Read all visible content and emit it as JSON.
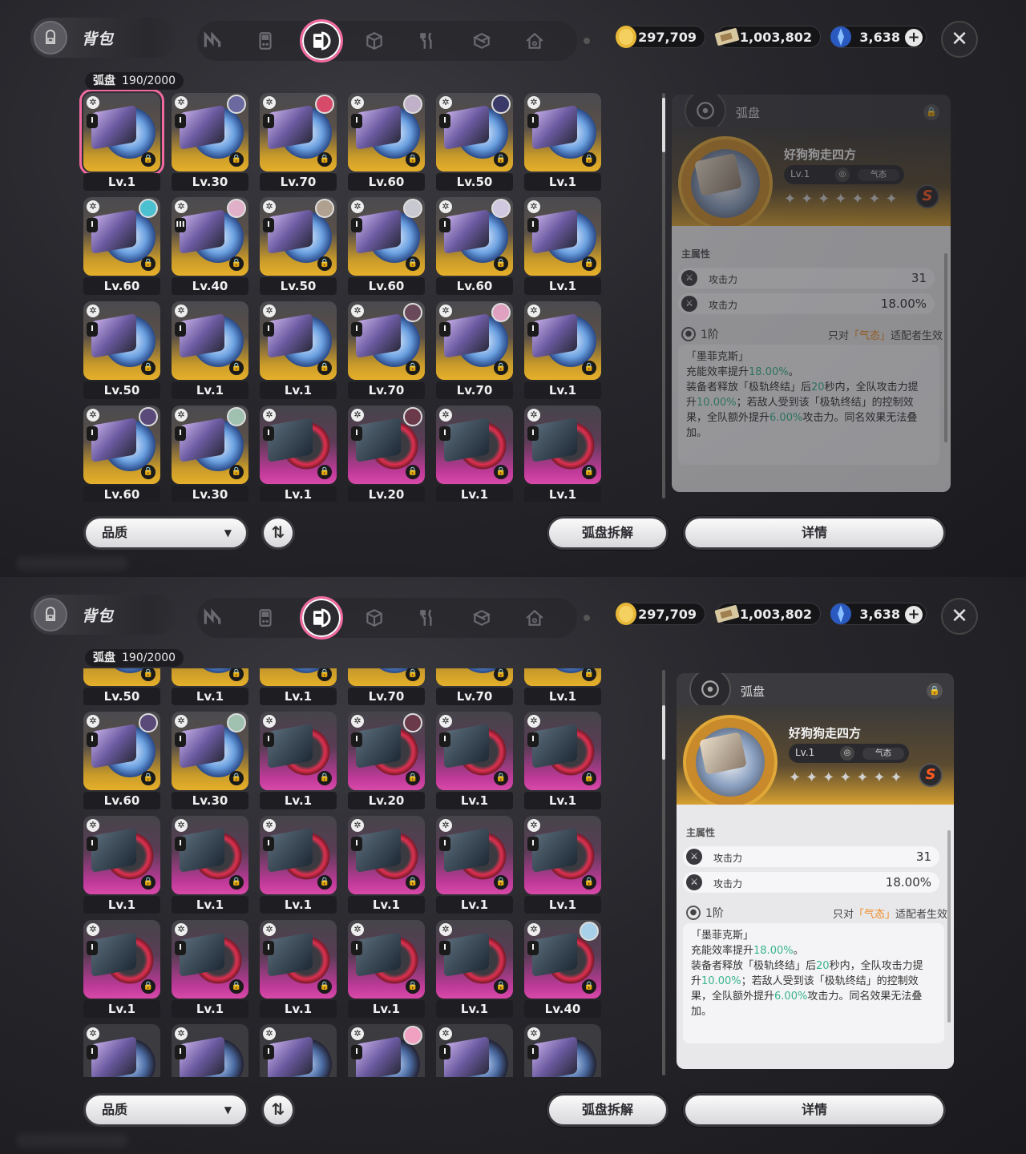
{
  "header": {
    "bag_title": "背包",
    "bag_icon": "backpack-icon",
    "tabs": [
      {
        "name": "agent-tab",
        "icon": "n-logo-icon"
      },
      {
        "name": "bangboo-tab",
        "icon": "handheld-icon"
      },
      {
        "name": "disc-tab",
        "icon": "disc-card-icon",
        "active": true
      },
      {
        "name": "material-tab",
        "icon": "cube-icon"
      },
      {
        "name": "food-tab",
        "icon": "fork-knife-icon"
      },
      {
        "name": "package-tab",
        "icon": "box-icon"
      },
      {
        "name": "home-tab",
        "icon": "house-icon"
      }
    ],
    "currency": {
      "dennies": "297,709",
      "film": "1,003,802",
      "polychrome": "3,638"
    },
    "close_icon": "close-icon"
  },
  "inventory": {
    "label": "弧盘",
    "count": "190/2000"
  },
  "grid_panel_1": [
    [
      {
        "lv": "Lv.1",
        "theme": "gold",
        "sel": true,
        "roman": "I"
      },
      {
        "lv": "Lv.30",
        "theme": "gold",
        "roman": "I",
        "ava": "#6a6aa0"
      },
      {
        "lv": "Lv.70",
        "theme": "gold",
        "roman": "I",
        "ava": "#d84a6a"
      },
      {
        "lv": "Lv.60",
        "theme": "gold",
        "roman": "I",
        "ava": "#c0b0c8"
      },
      {
        "lv": "Lv.50",
        "theme": "gold",
        "roman": "I",
        "ava": "#3a3a6a"
      },
      {
        "lv": "Lv.1",
        "theme": "gold",
        "roman": "I"
      }
    ],
    [
      {
        "lv": "Lv.60",
        "theme": "gold",
        "roman": "I",
        "ava": "#4ac0d0"
      },
      {
        "lv": "Lv.40",
        "theme": "gold",
        "roman": "III",
        "ava": "#e0b0c8"
      },
      {
        "lv": "Lv.50",
        "theme": "gold",
        "roman": "I",
        "ava": "#b0a090"
      },
      {
        "lv": "Lv.60",
        "theme": "gold",
        "roman": "I",
        "ava": "#c8c8d0"
      },
      {
        "lv": "Lv.60",
        "theme": "gold",
        "roman": "I",
        "ava": "#d0c8e0"
      },
      {
        "lv": "Lv.1",
        "theme": "gold",
        "roman": "I"
      }
    ],
    [
      {
        "lv": "Lv.50",
        "theme": "gold",
        "roman": "I"
      },
      {
        "lv": "Lv.1",
        "theme": "gold",
        "roman": "I"
      },
      {
        "lv": "Lv.1",
        "theme": "gold",
        "roman": "I"
      },
      {
        "lv": "Lv.70",
        "theme": "gold",
        "roman": "I",
        "ava": "#6a4a5a"
      },
      {
        "lv": "Lv.70",
        "theme": "gold",
        "roman": "I",
        "ava": "#e0a0c0"
      },
      {
        "lv": "Lv.1",
        "theme": "gold",
        "roman": "I"
      }
    ],
    [
      {
        "lv": "Lv.60",
        "theme": "gold",
        "roman": "I",
        "ava": "#5a4a7a"
      },
      {
        "lv": "Lv.30",
        "theme": "gold",
        "roman": "I",
        "ava": "#a0c0b0"
      },
      {
        "lv": "Lv.1",
        "theme": "pink",
        "roman": "I"
      },
      {
        "lv": "Lv.20",
        "theme": "pink",
        "roman": "I",
        "ava": "#6a3a4a"
      },
      {
        "lv": "Lv.1",
        "theme": "pink",
        "roman": "I"
      },
      {
        "lv": "Lv.1",
        "theme": "pink",
        "roman": "I"
      }
    ]
  ],
  "grid_panel_2": [
    [
      {
        "lv": "Lv.50",
        "theme": "gold",
        "roman": "I"
      },
      {
        "lv": "Lv.1",
        "theme": "gold",
        "roman": "I"
      },
      {
        "lv": "Lv.1",
        "theme": "gold",
        "roman": "I"
      },
      {
        "lv": "Lv.70",
        "theme": "gold",
        "roman": "I"
      },
      {
        "lv": "Lv.70",
        "theme": "gold",
        "roman": "I"
      },
      {
        "lv": "Lv.1",
        "theme": "gold",
        "roman": "I"
      }
    ],
    [
      {
        "lv": "Lv.60",
        "theme": "gold",
        "roman": "I",
        "ava": "#5a4a7a"
      },
      {
        "lv": "Lv.30",
        "theme": "gold",
        "roman": "I",
        "ava": "#a0c0b0"
      },
      {
        "lv": "Lv.1",
        "theme": "pink",
        "roman": "I"
      },
      {
        "lv": "Lv.20",
        "theme": "pink",
        "roman": "I",
        "ava": "#6a3a4a"
      },
      {
        "lv": "Lv.1",
        "theme": "pink",
        "roman": "I"
      },
      {
        "lv": "Lv.1",
        "theme": "pink",
        "roman": "I"
      }
    ],
    [
      {
        "lv": "Lv.1",
        "theme": "pink",
        "roman": "I"
      },
      {
        "lv": "Lv.1",
        "theme": "pink",
        "roman": "I"
      },
      {
        "lv": "Lv.1",
        "theme": "pink",
        "roman": "I"
      },
      {
        "lv": "Lv.1",
        "theme": "pink",
        "roman": "I"
      },
      {
        "lv": "Lv.1",
        "theme": "pink",
        "roman": "I"
      },
      {
        "lv": "Lv.1",
        "theme": "pink",
        "roman": "I"
      }
    ],
    [
      {
        "lv": "Lv.1",
        "theme": "pink",
        "roman": "I"
      },
      {
        "lv": "Lv.1",
        "theme": "pink",
        "roman": "I"
      },
      {
        "lv": "Lv.1",
        "theme": "pink",
        "roman": "I"
      },
      {
        "lv": "Lv.1",
        "theme": "pink",
        "roman": "I"
      },
      {
        "lv": "Lv.1",
        "theme": "pink",
        "roman": "I"
      },
      {
        "lv": "Lv.40",
        "theme": "pink",
        "roman": "I",
        "ava": "#a8d0e8"
      }
    ],
    [
      {
        "lv": "",
        "theme": "dark",
        "roman": "I"
      },
      {
        "lv": "",
        "theme": "dark",
        "roman": "I"
      },
      {
        "lv": "",
        "theme": "dark",
        "roman": "I"
      },
      {
        "lv": "",
        "theme": "dark",
        "roman": "I",
        "ava": "#f0a0c0"
      },
      {
        "lv": "",
        "theme": "dark",
        "roman": "I"
      },
      {
        "lv": "",
        "theme": "dark",
        "roman": "I"
      }
    ]
  ],
  "detail": {
    "category": "弧盘",
    "name": "好狗狗走四方",
    "level": "Lv.1",
    "tag": "气态",
    "rank": "S",
    "main_attr_label": "主属性",
    "stats": [
      {
        "name": "攻击力",
        "value": "31"
      },
      {
        "name": "攻击力",
        "value": "18.00%"
      }
    ],
    "tier": "1阶",
    "tier_note_pre": "只对",
    "tier_note_tag": "「气态」",
    "tier_note_post": "适配者生效",
    "desc": {
      "title": "「墨菲克斯」",
      "l1a": "充能效率提升",
      "l1b": "18.00%",
      "l1c": "。",
      "l2a": "装备者释放「极轨终结」后",
      "l2b": "20",
      "l2c": "秒内，全队攻击力提",
      "l3a": "升",
      "l3b": "10.00%",
      "l3c": "；若敌人受到该「极轨终结」的控制效",
      "l4a": "果，全队额外提升",
      "l4b": "6.00%",
      "l4c": "攻击力。同名效果无法叠",
      "l5": "加。"
    }
  },
  "bottom": {
    "quality": "品质",
    "dismantle": "弧盘拆解",
    "details": "详情"
  }
}
